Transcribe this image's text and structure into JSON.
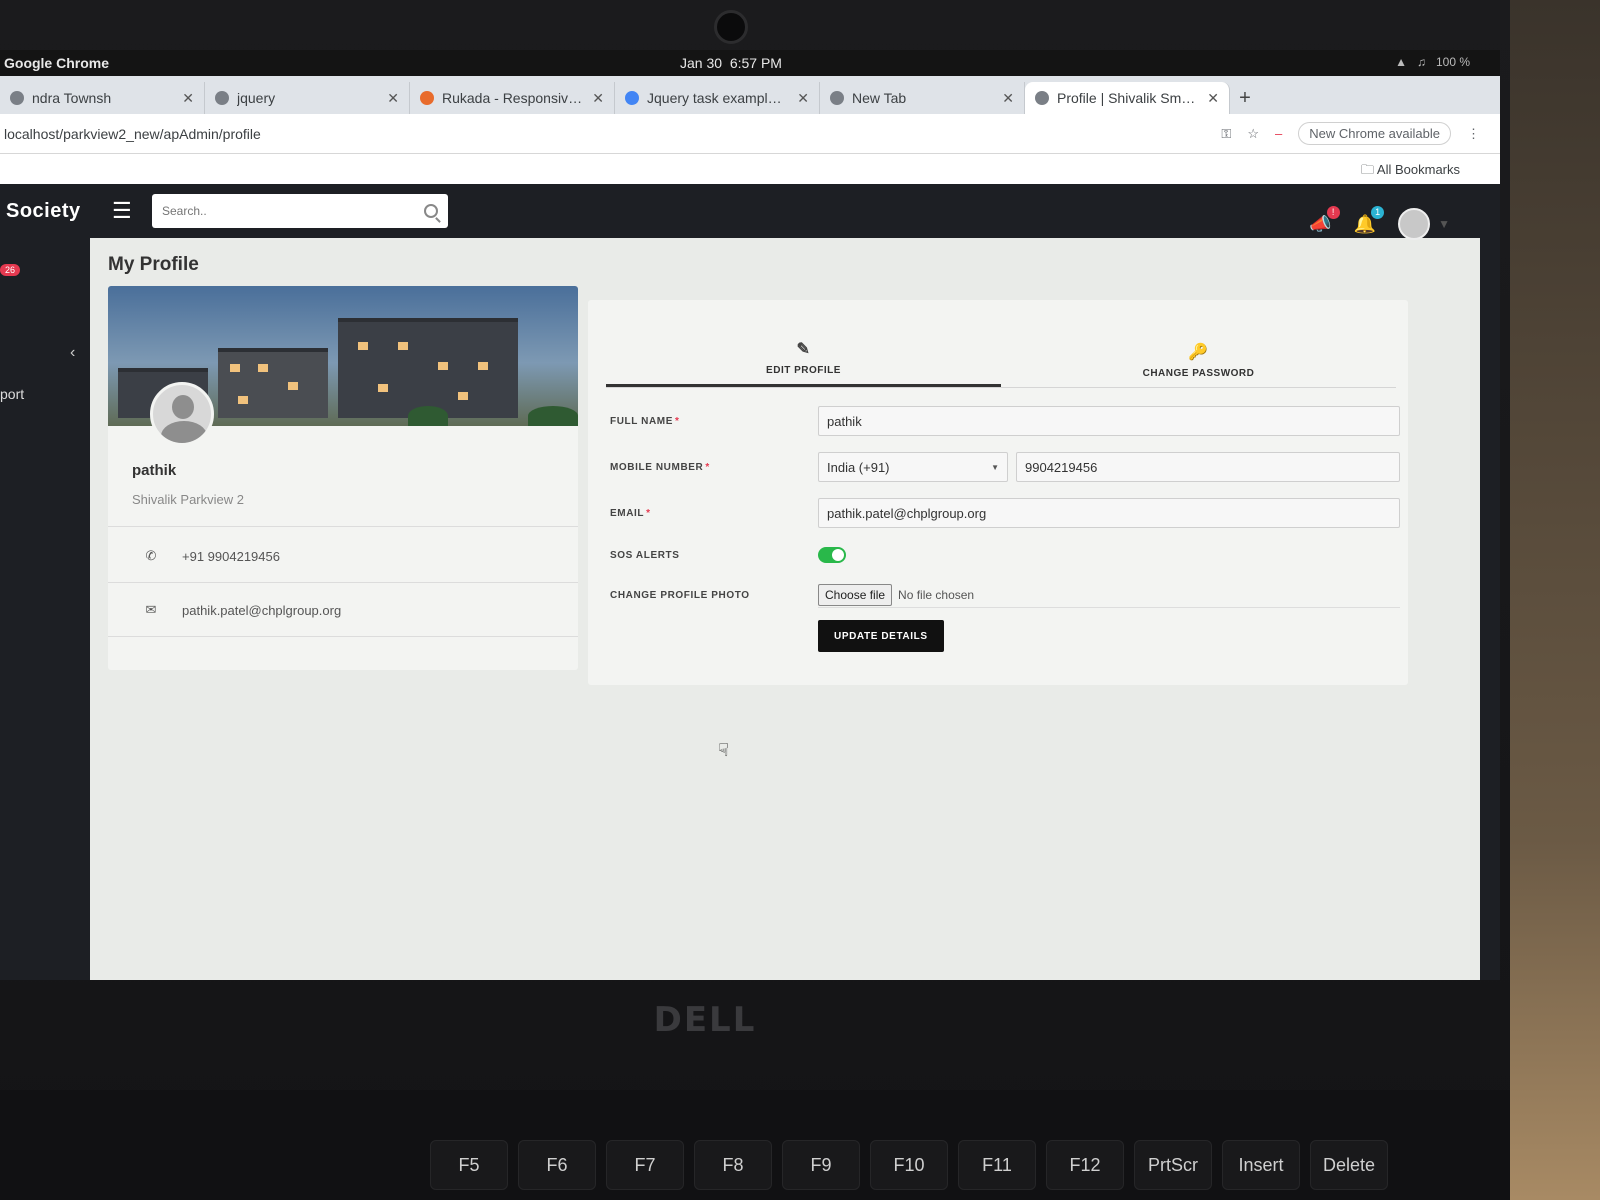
{
  "os": {
    "app_name": "Google Chrome",
    "date": "Jan 30",
    "time": "6:57 PM",
    "battery": "100 %"
  },
  "browser": {
    "tabs": [
      {
        "title": "ndra Townsh",
        "icon": "page-icon"
      },
      {
        "title": "jquery",
        "icon": "globe-icon"
      },
      {
        "title": "Rukada - Responsive Bo",
        "icon": "rukada-icon"
      },
      {
        "title": "Jquery task example wi",
        "icon": "google-icon"
      },
      {
        "title": "New Tab",
        "icon": "chrome-icon"
      },
      {
        "title": "Profile | Shivalik Smart S",
        "icon": "page-icon",
        "active": true
      }
    ],
    "url": "localhost/parkview2_new/apAdmin/profile",
    "chrome_update": "New Chrome available",
    "bookmarks_label": "All Bookmarks"
  },
  "app": {
    "brand": "Society",
    "search_placeholder": "Search..",
    "sidebar_badge": "26",
    "sidebar_item": "port",
    "notifications": {
      "announce_badge": "!",
      "bell_badge": "1"
    }
  },
  "profile": {
    "page_title": "My Profile",
    "name": "pathik",
    "society": "Shivalik Parkview 2",
    "phone": "+91 9904219456",
    "email": "pathik.patel@chplgroup.org"
  },
  "form": {
    "tabs": {
      "edit": "EDIT PROFILE",
      "password": "CHANGE PASSWORD"
    },
    "labels": {
      "full_name": "FULL NAME",
      "mobile": "MOBILE NUMBER",
      "email": "EMAIL",
      "sos": "SOS ALERTS",
      "photo": "CHANGE PROFILE PHOTO"
    },
    "required_mark": "*",
    "values": {
      "full_name": "pathik",
      "country": "India (+91)",
      "mobile": "9904219456",
      "email": "pathik.patel@chplgroup.org",
      "sos_enabled": true
    },
    "file": {
      "button": "Choose file",
      "status": "No file chosen"
    },
    "submit": "UPDATE DETAILS"
  },
  "keyboard": [
    "F5",
    "F6",
    "F7",
    "F8",
    "F9",
    "F10",
    "F11",
    "F12",
    "PrtScr",
    "Insert",
    "Delete"
  ],
  "hardware": {
    "logo": "DELL"
  }
}
